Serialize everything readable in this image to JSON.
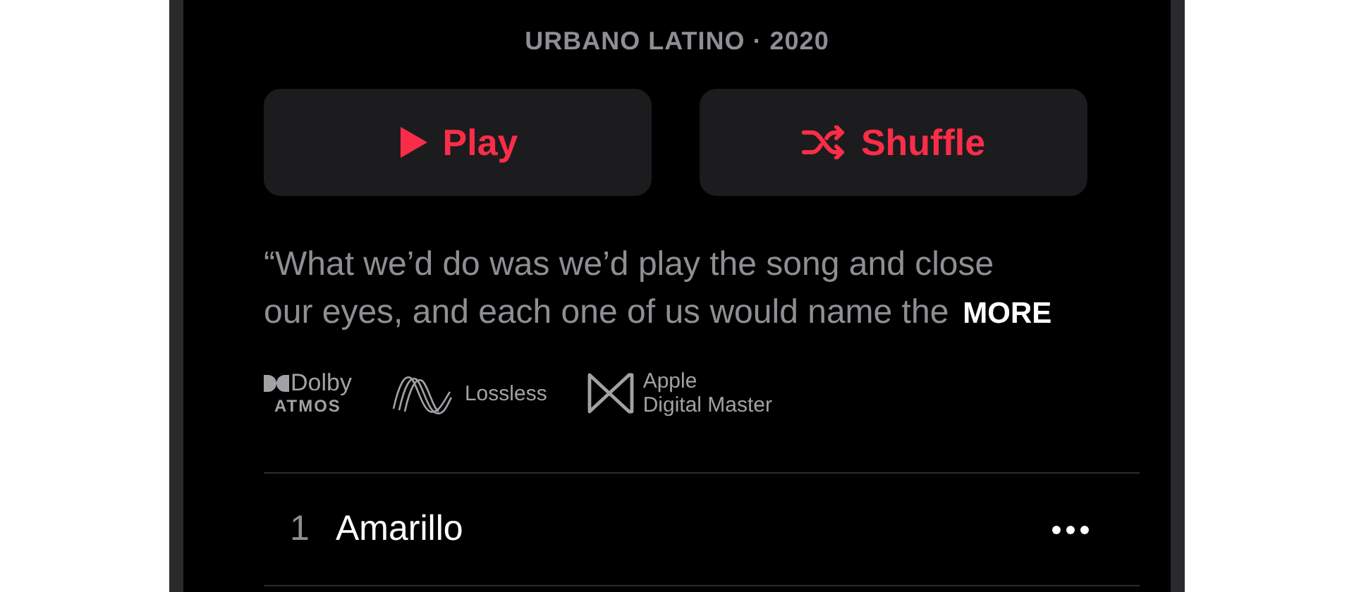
{
  "subtitle": "URBANO LATINO · 2020",
  "buttons": [
    {
      "kind": "play",
      "label": "Play"
    },
    {
      "kind": "shuffle",
      "label": "Shuffle"
    }
  ],
  "description": {
    "text": "“What we’d do was we’d play the song and close\nour eyes, and each one of us would name the",
    "more": "MORE"
  },
  "badges": [
    {
      "kind": "dolby",
      "lines": [
        "Dolby",
        "ATMOS"
      ]
    },
    {
      "kind": "lossless",
      "lines": [
        "Lossless"
      ]
    },
    {
      "kind": "master",
      "lines": [
        "Apple",
        "Digital Master"
      ]
    }
  ],
  "tracks": [
    {
      "number": "1",
      "title": "Amarillo"
    }
  ]
}
